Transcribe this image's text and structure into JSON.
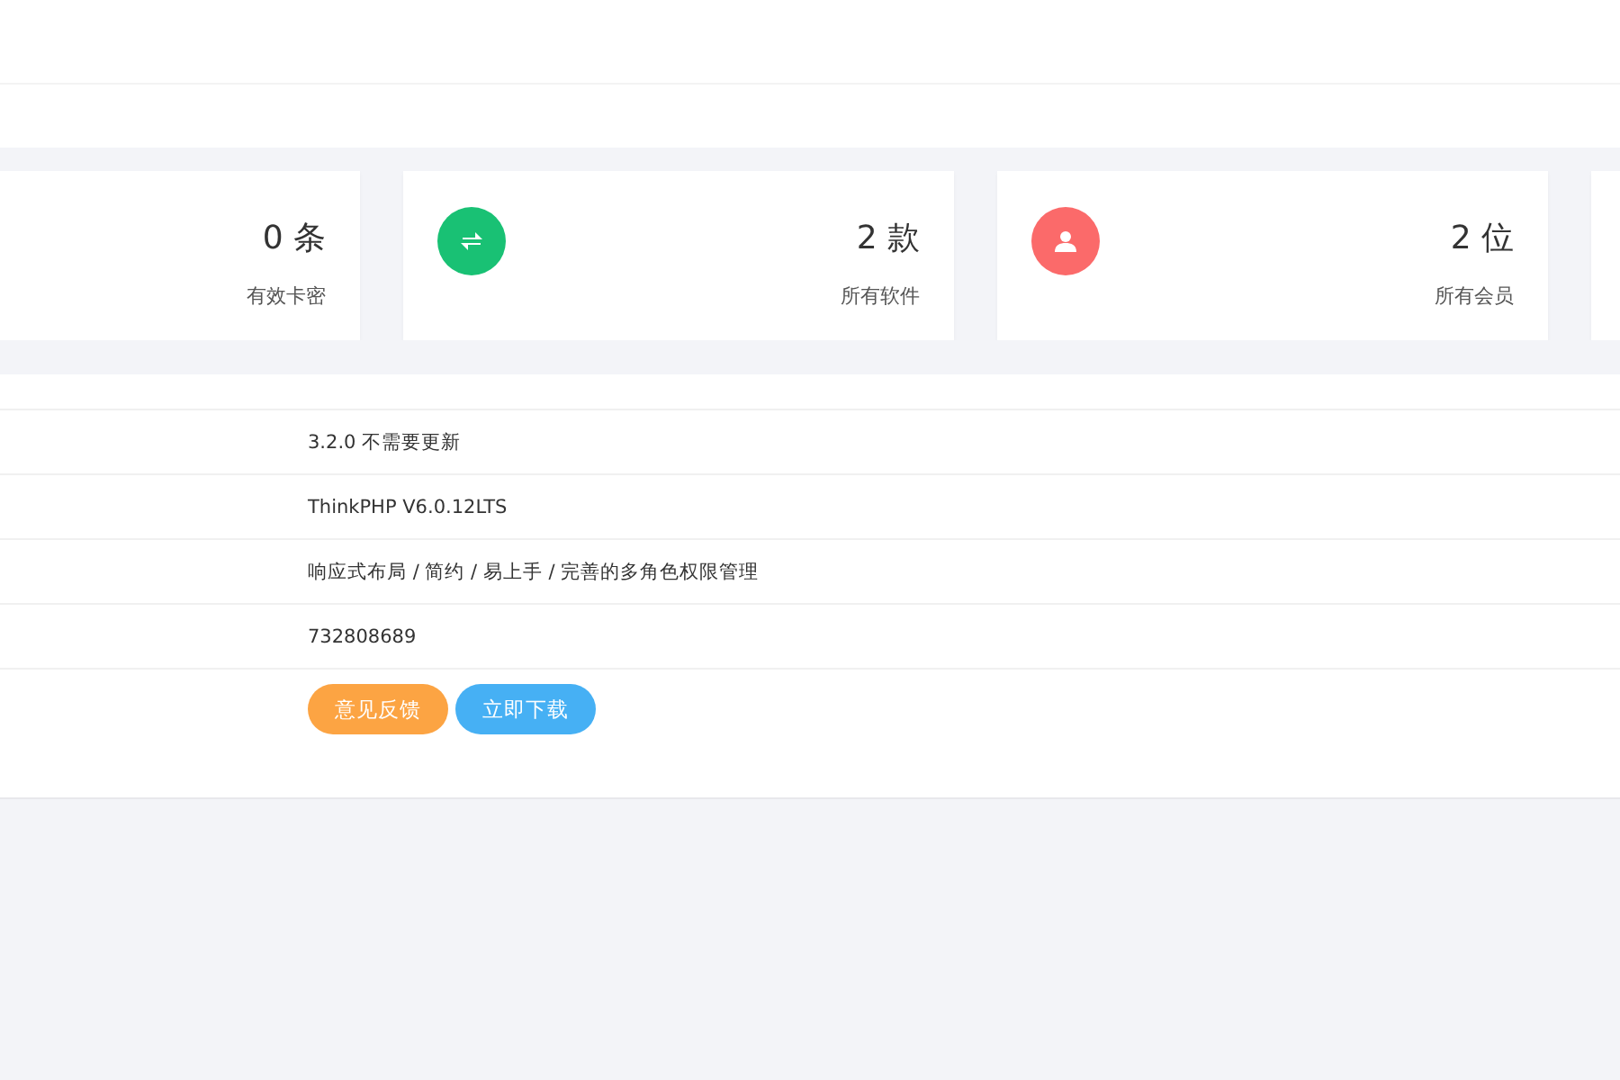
{
  "stats": [
    {
      "kind": "plain",
      "value": "0 条",
      "label": "有效卡密"
    },
    {
      "kind": "swap",
      "value": "2 款",
      "label": "所有软件",
      "color": "#19c174"
    },
    {
      "kind": "user",
      "value": "2 位",
      "label": "所有会员",
      "color": "#fb6a6a"
    },
    {
      "kind": "blank"
    }
  ],
  "info_rows": [
    {
      "kind": "text",
      "value": "3.2.0 不需要更新"
    },
    {
      "kind": "text",
      "value": "ThinkPHP V6.0.12LTS"
    },
    {
      "kind": "text",
      "value": "响应式布局 / 简约 / 易上手 / 完善的多角色权限管理"
    },
    {
      "kind": "text",
      "value": "732808689"
    },
    {
      "kind": "buttons",
      "buttons": [
        {
          "label": "意见反馈",
          "color": "#fca443"
        },
        {
          "label": "立即下载",
          "color": "#46b0f4"
        }
      ]
    }
  ]
}
